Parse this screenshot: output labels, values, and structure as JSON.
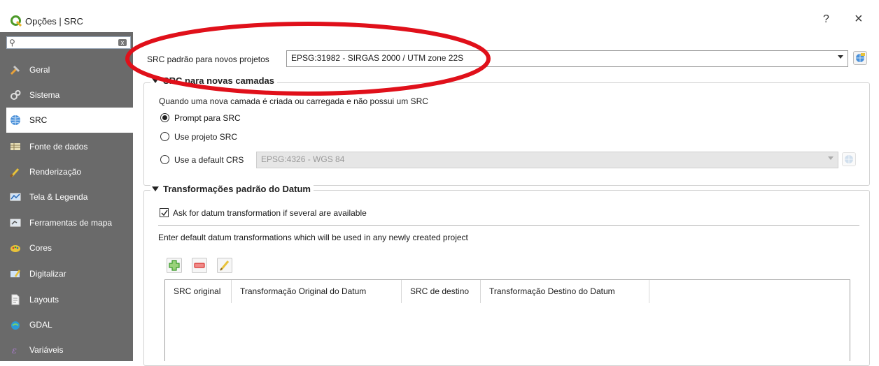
{
  "window": {
    "title": "Opções | SRC",
    "help_label": "?",
    "close_label": "×"
  },
  "sidebar": {
    "search_placeholder": "",
    "items": [
      {
        "label": "Geral",
        "icon": "tools-icon"
      },
      {
        "label": "Sistema",
        "icon": "system-icon"
      },
      {
        "label": "SRC",
        "icon": "globe-icon",
        "active": true
      },
      {
        "label": "Fonte de dados",
        "icon": "table-icon"
      },
      {
        "label": "Renderização",
        "icon": "brush-icon"
      },
      {
        "label": "Tela & Legenda",
        "icon": "map-canvas-icon"
      },
      {
        "label": "Ferramentas de mapa",
        "icon": "map-tools-icon"
      },
      {
        "label": "Cores",
        "icon": "palette-icon"
      },
      {
        "label": "Digitalizar",
        "icon": "digitize-icon"
      },
      {
        "label": "Layouts",
        "icon": "layout-icon"
      },
      {
        "label": "GDAL",
        "icon": "gdal-icon"
      },
      {
        "label": "Variáveis",
        "icon": "variables-icon"
      }
    ]
  },
  "project_crs": {
    "label": "SRC padrão para novos projetos",
    "value": "EPSG:31982 - SIRGAS 2000 / UTM zone 22S"
  },
  "new_layers": {
    "heading": "SRC para novas camadas",
    "description": "Quando uma nova camada é criada ou carregada e não possui um SRC",
    "options": [
      "Prompt para SRC",
      "Use projeto SRC",
      "Use a default CRS"
    ],
    "selected_option": "Prompt para SRC",
    "default_crs_value": "EPSG:4326 - WGS 84"
  },
  "datum": {
    "heading": "Transformações padrão do Datum",
    "ask_label": "Ask for datum transformation if several are available",
    "ask_checked": true,
    "enter_text": "Enter default datum transformations which will be used in any newly created project",
    "columns": [
      "SRC original",
      "Transformação Original do Datum",
      "SRC de destino",
      "Transformação Destino do Datum"
    ]
  },
  "colors": {
    "sidebar_bg": "#6a6a6a",
    "highlight_ellipse": "#e0101a",
    "add_green": "#3a9a2a",
    "remove_red": "#d8322f",
    "edit_yellow": "#e8c23a"
  }
}
